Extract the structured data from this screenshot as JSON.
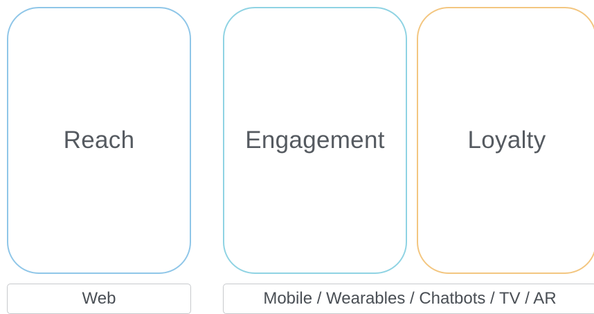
{
  "stages": [
    {
      "label": "Reach",
      "border_color": "#8fc6e8"
    },
    {
      "label": "Engagement",
      "border_color": "#8fd3e3"
    },
    {
      "label": "Loyalty",
      "border_color": "#f3c680"
    }
  ],
  "channels": [
    {
      "label": "Web"
    },
    {
      "label": "Mobile / Wearables / Chatbots / TV / AR"
    }
  ]
}
